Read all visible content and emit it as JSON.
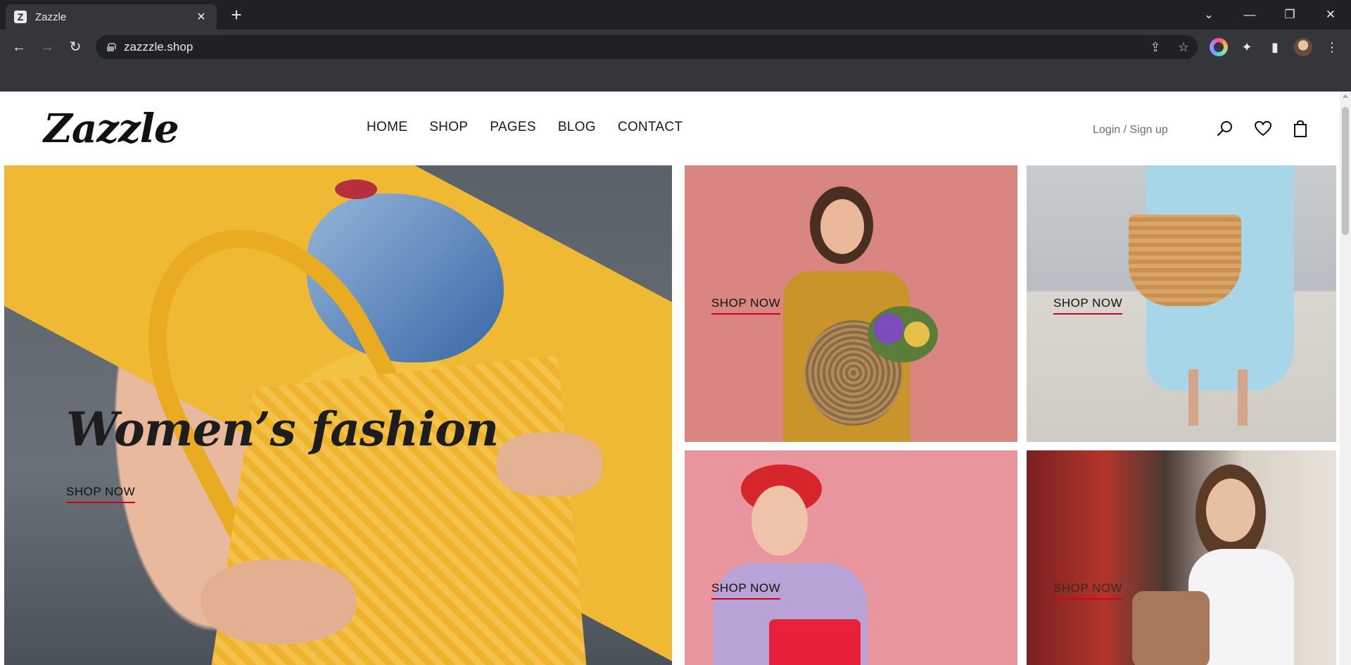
{
  "browser": {
    "tab_title": "Zazzle",
    "favicon_letter": "Z",
    "url": "zazzzle.shop"
  },
  "site": {
    "logo": "Zazzle",
    "nav": [
      "HOME",
      "SHOP",
      "PAGES",
      "BLOG",
      "CONTACT"
    ],
    "login": "Login / Sign up"
  },
  "hero": {
    "title": "Women’s fashion",
    "cta": "SHOP NOW"
  },
  "tiles": [
    {
      "cta": "SHOP NOW"
    },
    {
      "cta": "SHOP NOW"
    },
    {
      "cta": "SHOP NOW"
    },
    {
      "cta": "SHOP NOW"
    }
  ],
  "colors": {
    "accent_underline": "#d0021b",
    "chrome_bg": "#202124",
    "toolbar_bg": "#35363a"
  }
}
